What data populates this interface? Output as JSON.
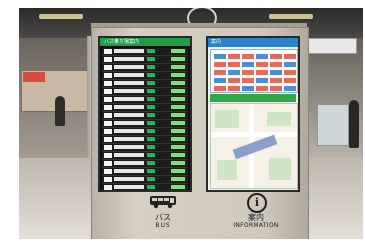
{
  "kiosk": {
    "bus_screen_title": "バス乗り場案内",
    "info_screen_title": "案内",
    "bus_label_jp": "バス",
    "bus_label_en": "BUS",
    "info_label_jp": "案内",
    "info_label_en": "INFORMATION",
    "info_glyph": "i"
  },
  "icons": [
    "bus-icon",
    "information-icon"
  ],
  "colors": {
    "bus_header": "#1f9d4a",
    "info_header": "#2a82c9",
    "map_header": "#31a845"
  }
}
